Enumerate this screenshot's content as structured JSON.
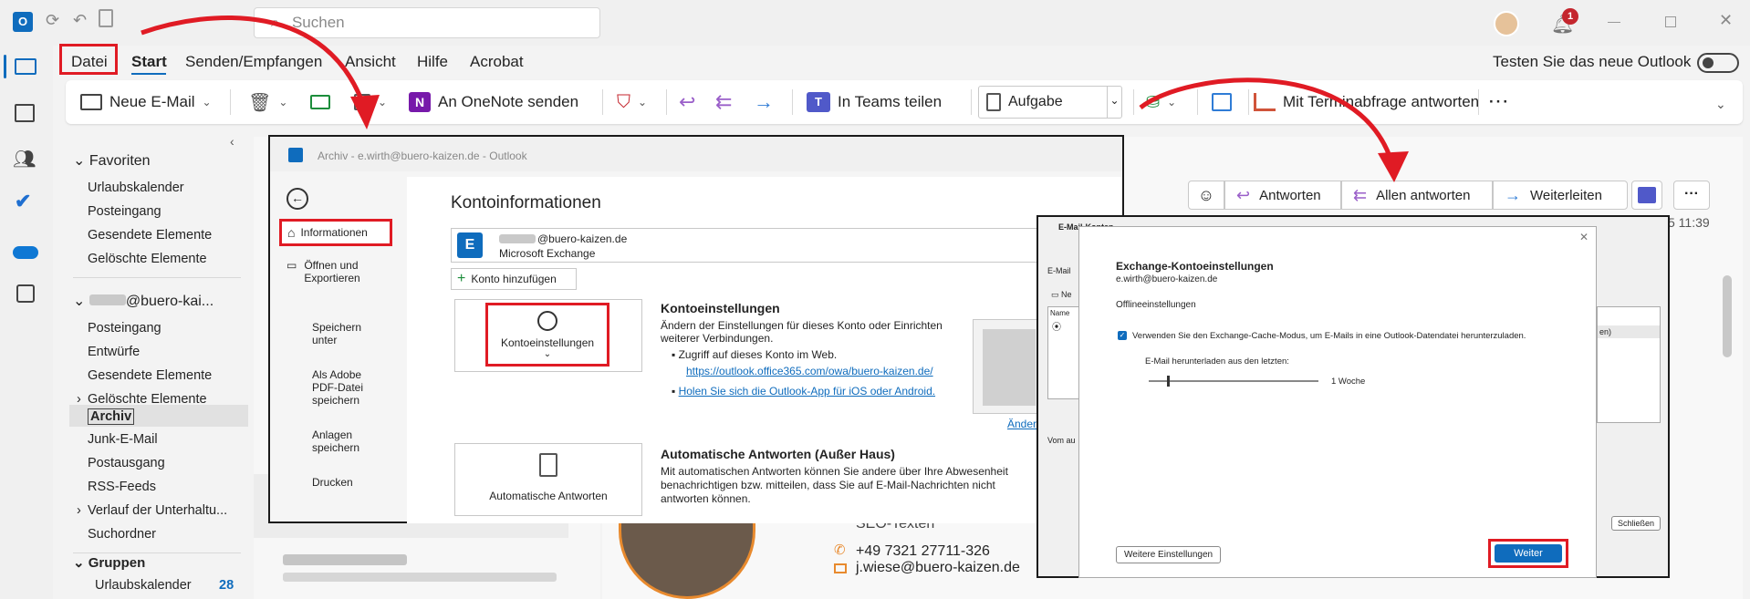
{
  "titlebar": {
    "search_placeholder": "Suchen",
    "notification_count": "1"
  },
  "menu": {
    "datei": "Datei",
    "start": "Start",
    "senden": "Senden/Empfangen",
    "ansicht": "Ansicht",
    "hilfe": "Hilfe",
    "acrobat": "Acrobat",
    "new_outlook": "Testen Sie das neue Outlook"
  },
  "ribbon": {
    "new_mail": "Neue E-Mail",
    "onenote": "An OneNote senden",
    "teams": "In Teams teilen",
    "task": "Aufgabe",
    "meeting_reply": "Mit Terminabfrage antworten",
    "more": "···"
  },
  "nav": {
    "favorites_header": "Favoriten",
    "favorites": [
      "Urlaubskalender",
      "Posteingang",
      "Gesendete Elemente",
      "Gelöschte Elemente"
    ],
    "account_header": "@buero-kai...",
    "folders": [
      "Posteingang",
      "Entwürfe",
      "Gesendete Elemente",
      "Gelöschte Elemente",
      "Archiv",
      "Junk-E-Mail",
      "Postausgang",
      "RSS-Feeds",
      "Verlauf der Unterhaltu...",
      "Suchordner"
    ],
    "groups_header": "Gruppen",
    "groups": [
      {
        "label": "Urlaubskalender",
        "count": "28"
      }
    ]
  },
  "reading": {
    "reply": "Antworten",
    "reply_all": "Allen antworten",
    "forward": "Weiterleiten",
    "time": "5 11:39",
    "seo": "SEO-Texten",
    "phone": "+49 7321 27711-326",
    "email": "j.wiese@buero-kaizen.de"
  },
  "backstage": {
    "title": "Archiv - e.wirth@buero-kaizen.de - Outlook",
    "nav": [
      "Informationen",
      "Öffnen und Exportieren",
      "Speichern unter",
      "Als Adobe PDF-Datei speichern",
      "Anlagen speichern",
      "Drucken"
    ],
    "heading": "Kontoinformationen",
    "account_email": "@buero-kaizen.de",
    "account_type": "Microsoft Exchange",
    "add_account": "Konto hinzufügen",
    "settings_btn": "Kontoeinstellungen",
    "settings_title": "Kontoeinstellungen",
    "settings_desc": "Ändern der Einstellungen für dieses Konto oder Einrichten weiterer Verbindungen.",
    "bullet1": "Zugriff auf dieses Konto im Web.",
    "link1": "https://outlook.office365.com/owa/buero-kaizen.de/",
    "link2": "Holen Sie sich die Outlook-App für iOS oder Android.",
    "change": "Ändern",
    "auto_btn": "Automatische Antworten",
    "auto_title": "Automatische Antworten (Außer Haus)",
    "auto_desc": "Mit automatischen Antworten können Sie andere über Ihre Abwesenheit benachrichtigen bzw. mitteilen, dass Sie auf E-Mail-Nachrichten nicht antworten können."
  },
  "exchange": {
    "bg_title": "E-Mail-Konten",
    "bg_tab": "E-Mail",
    "bg_new": "Ne",
    "bg_name": "Name",
    "bg_vom": "Vom au",
    "bg_close": "Schließen",
    "bg_suffix": "en)",
    "title": "Exchange-Kontoeinstellungen",
    "email": "e.wirth@buero-kaizen.de",
    "offline": "Offlineeinstellungen",
    "cache_label": "Verwenden Sie den Exchange-Cache-Modus, um E-Mails in eine Outlook-Datendatei herunterzuladen.",
    "download_label": "E-Mail herunterladen aus den letzten:",
    "slider_value": "1 Woche",
    "more_settings": "Weitere Einstellungen",
    "next": "Weiter"
  },
  "colors": {
    "accent": "#0f6cbd",
    "highlight": "#e01b24",
    "arrow": "#e01b24"
  }
}
